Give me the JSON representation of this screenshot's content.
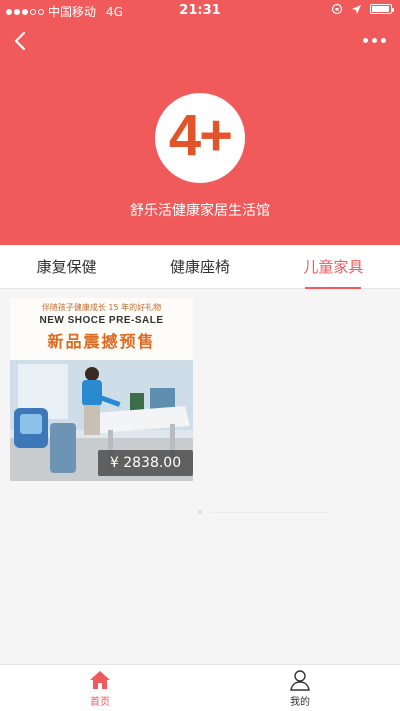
{
  "status_bar": {
    "carrier": "中国移动",
    "network": "4G",
    "time": "21:31"
  },
  "header": {
    "back_icon": "chevron-left-icon",
    "more_icon": "more-dots-icon",
    "logo_text": "4+",
    "store_name": "舒乐活健康家居生活馆",
    "bg_color": "#f15a5b"
  },
  "tabs": [
    {
      "label": "康复保健",
      "active": false
    },
    {
      "label": "健康座椅",
      "active": false
    },
    {
      "label": "儿童家具",
      "active": true
    }
  ],
  "products": [
    {
      "promo_line1": "伴随孩子健康成长 15 年的好礼物",
      "promo_line2": "NEW SHOCE PRE-SALE",
      "promo_line3": "新品震撼预售",
      "price": "¥ 2838.00"
    }
  ],
  "bottom_nav": [
    {
      "label": "首页",
      "icon": "home-icon",
      "active": true
    },
    {
      "label": "我的",
      "icon": "user-icon",
      "active": false
    }
  ],
  "colors": {
    "accent": "#f15a5b",
    "logo_orange": "#e2552b"
  }
}
